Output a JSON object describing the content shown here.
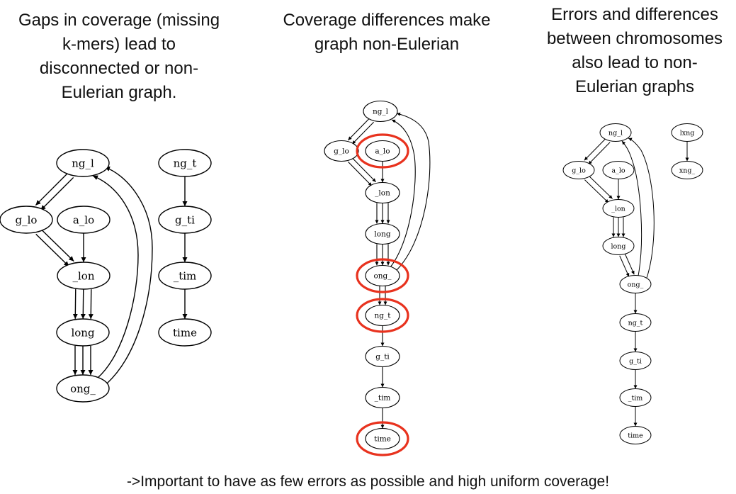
{
  "panels": [
    {
      "title_lines": [
        "Gaps in coverage (missing",
        "k-mers) lead to",
        "disconnected or non-",
        "Eulerian graph."
      ],
      "nodes": {
        "ng_l": "ng_l",
        "g_lo": "g_lo",
        "a_lo": "a_lo",
        "_lon": "_lon",
        "long": "long",
        "ong_": "ong_",
        "ng_t": "ng_t",
        "g_ti": "g_ti",
        "_tim": "_tim",
        "time": "time"
      }
    },
    {
      "title_lines": [
        "Coverage differences make",
        "graph non-Eulerian"
      ],
      "nodes": {
        "ng_l": "ng_l",
        "g_lo": "g_lo",
        "a_lo": "a_lo",
        "_lon": "_lon",
        "long": "long",
        "ong_": "ong_",
        "ng_t": "ng_t",
        "g_ti": "g_ti",
        "_tim": "_tim",
        "time": "time"
      },
      "highlight_color": "#e8321e"
    },
    {
      "title_lines": [
        "Errors and differences",
        "between chromosomes",
        "also lead to non-",
        "Eulerian graphs"
      ],
      "nodes": {
        "ng_l": "ng_l",
        "g_lo": "g_lo",
        "a_lo": "a_lo",
        "_lon": "_lon",
        "long": "long",
        "ong_": "ong_",
        "ng_t": "ng_t",
        "g_ti": "g_ti",
        "_tim": "_tim",
        "time": "time",
        "lxng": "lxng",
        "xng_": "xng_"
      }
    }
  ],
  "footer": "->Important to have as few errors as possible and high uniform coverage!"
}
